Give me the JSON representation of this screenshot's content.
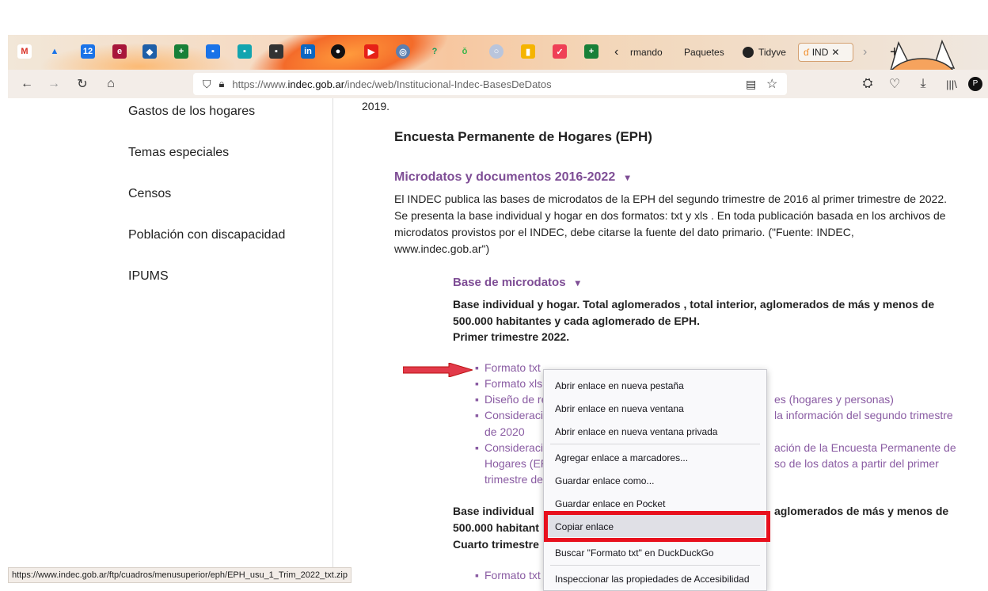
{
  "browser": {
    "tabs": [
      {
        "label": "rmando"
      },
      {
        "label": "Paquetes"
      },
      {
        "label": "Tidyve"
      },
      {
        "label": "IND"
      }
    ],
    "url": {
      "prefix": "https://www.",
      "host": "indec.gob.ar",
      "path": "/indec/web/Institucional-Indec-BasesDeDatos"
    },
    "status_url": "https://www.indec.gob.ar/ftp/cuadros/menusuperior/eph/EPH_usu_1_Trim_2022_txt.zip"
  },
  "sidebar": {
    "items": [
      "Gastos de los hogares",
      "Temas especiales",
      "Censos",
      "Población con discapacidad",
      "IPUMS"
    ]
  },
  "main": {
    "year_fragment": "2019.",
    "eph_heading": "Encuesta Permanente de Hogares (EPH)",
    "micro_heading": "Microdatos y documentos 2016-2022",
    "caret": "▾",
    "intro": [
      "El INDEC publica las bases de microdatos de la EPH del segundo trimestre de 2016 al primer trimestre de 2022.",
      "Se presenta la base individual y hogar en dos formatos: txt y xls . En toda publicación basada en los archivos de",
      "microdatos provistos por el INDEC, debe citarse la fuente del dato primario. (\"Fuente: INDEC,",
      "www.indec.gob.ar\")"
    ],
    "base_heading": "Base de microdatos",
    "block1": [
      "Base individual y hogar. Total aglomerados , total interior, aglomerados de más y menos de",
      "500.000 habitantes y cada aglomerado de EPH.",
      "Primer trimestre 2022."
    ],
    "links1": [
      "Formato txt",
      "Formato xls",
      "Diseño de re",
      "Consideraci",
      "de 2020",
      "Consideraci",
      "Hogares (EP",
      "trimestre de"
    ],
    "links_right": [
      "es (hogares y personas)",
      "la información del segundo trimestre",
      "ación de la Encuesta Permanente de",
      "so de los datos a partir del primer"
    ],
    "block2": [
      "Base individual",
      "aglomerados de más y menos de",
      "500.000 habitant",
      "Cuarto trimestre"
    ],
    "link_bottom": "Formato txt"
  },
  "context_menu": {
    "items": [
      "Abrir enlace en nueva pestaña",
      "Abrir enlace en nueva ventana",
      "Abrir enlace en nueva ventana privada",
      "Agregar enlace a marcadores...",
      "Guardar enlace como...",
      "Guardar enlace en Pocket",
      "Copiar enlace",
      "Buscar \"Formato txt\" en DuckDuckGo",
      "Inspeccionar las propiedades de Accesibilidad"
    ]
  },
  "colors": {
    "highlight": "#e8101d",
    "link": "#8a5ca3"
  }
}
